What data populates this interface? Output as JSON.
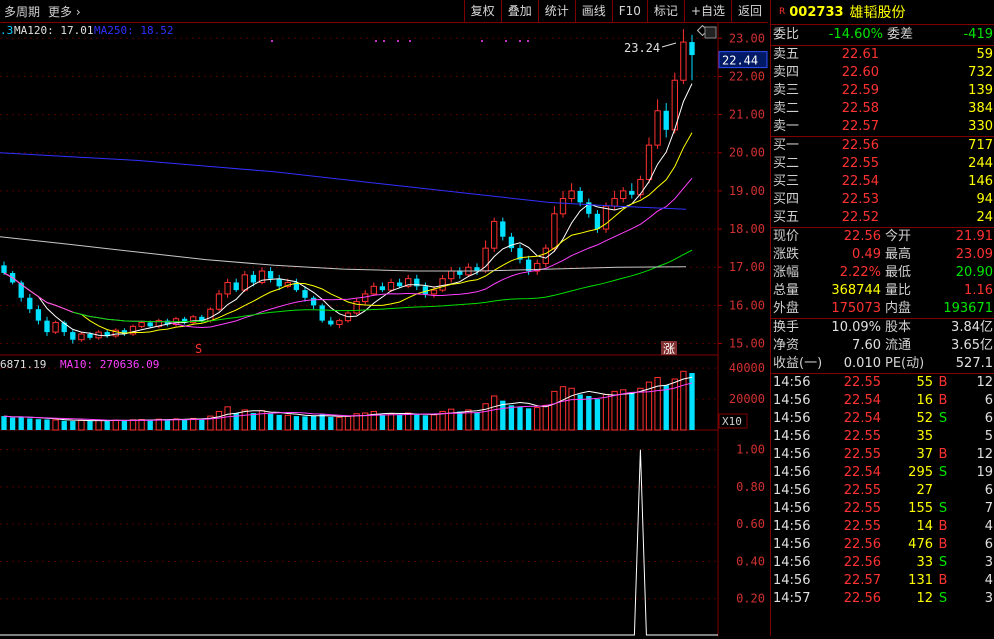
{
  "toolbar": {
    "period": "多周期",
    "more": "更多",
    "buttons": [
      "复权",
      "叠加",
      "统计",
      "画线",
      "F10",
      "标记",
      "+自选",
      "返回"
    ]
  },
  "chart": {
    "ma_legend": [
      {
        "label": ".3",
        "color": "#00ccff"
      },
      {
        "label": "MA120: 17.01",
        "color": "#e0e0e0"
      },
      {
        "label": "MA250: 18.52",
        "color": "#3030ff"
      }
    ],
    "price_ticks": [
      "23.00",
      "22.00",
      "21.00",
      "20.00",
      "19.00",
      "18.00",
      "17.00",
      "16.00",
      "15.00"
    ],
    "current_price": "22.44",
    "high_label": "23.24",
    "markers": [
      "S",
      "涨"
    ],
    "vol_legend": [
      {
        "label": "6871.19",
        "color": "#e0e0e0"
      },
      {
        "label": "MA10: 270636.09",
        "color": "#ff40ff"
      }
    ],
    "vol_ticks": [
      "40000",
      "20000"
    ],
    "vol_unit": "X10",
    "ind_ticks": [
      "1.00",
      "0.80",
      "0.60",
      "0.40",
      "0.20"
    ]
  },
  "quote": {
    "badge": "R",
    "code": "002733",
    "name": "雄韬股份",
    "weibi_label": "委比",
    "weibi": "-14.60%",
    "weicha_label": "委差",
    "weicha": "-419",
    "asks": [
      {
        "label": "卖五",
        "price": "22.61",
        "vol": "59"
      },
      {
        "label": "卖四",
        "price": "22.60",
        "vol": "732"
      },
      {
        "label": "卖三",
        "price": "22.59",
        "vol": "139"
      },
      {
        "label": "卖二",
        "price": "22.58",
        "vol": "384"
      },
      {
        "label": "卖一",
        "price": "22.57",
        "vol": "330"
      }
    ],
    "bids": [
      {
        "label": "买一",
        "price": "22.56",
        "vol": "717"
      },
      {
        "label": "买二",
        "price": "22.55",
        "vol": "244"
      },
      {
        "label": "买三",
        "price": "22.54",
        "vol": "146"
      },
      {
        "label": "买四",
        "price": "22.53",
        "vol": "94"
      },
      {
        "label": "买五",
        "price": "22.52",
        "vol": "24"
      }
    ],
    "stats": [
      {
        "l1": "现价",
        "v1": "22.56",
        "c1": "red",
        "l2": "今开",
        "v2": "21.91",
        "c2": "red"
      },
      {
        "l1": "涨跌",
        "v1": "0.49",
        "c1": "red",
        "l2": "最高",
        "v2": "23.09",
        "c2": "red"
      },
      {
        "l1": "涨幅",
        "v1": "2.22%",
        "c1": "red",
        "l2": "最低",
        "v2": "20.90",
        "c2": "grn"
      },
      {
        "l1": "总量",
        "v1": "368744",
        "c1": "yel",
        "l2": "量比",
        "v2": "1.16",
        "c2": "red"
      },
      {
        "l1": "外盘",
        "v1": "175073",
        "c1": "red",
        "l2": "内盘",
        "v2": "193671",
        "c2": "grn"
      }
    ],
    "stats2": [
      {
        "l1": "换手",
        "v1": "10.09%",
        "c1": "wht",
        "l2": "股本",
        "v2": "3.84亿",
        "c2": "wht"
      },
      {
        "l1": "净资",
        "v1": "7.60",
        "c1": "wht",
        "l2": "流通",
        "v2": "3.65亿",
        "c2": "wht"
      },
      {
        "l1": "收益(一)",
        "v1": "0.010",
        "c1": "wht",
        "l2": "PE(动)",
        "v2": "527.1",
        "c2": "wht"
      }
    ],
    "ticks": [
      {
        "t": "14:56",
        "p": "22.55",
        "v": "55",
        "bs": "B",
        "n": "12"
      },
      {
        "t": "14:56",
        "p": "22.54",
        "v": "16",
        "bs": "B",
        "n": "6"
      },
      {
        "t": "14:56",
        "p": "22.54",
        "v": "52",
        "bs": "S",
        "n": "6"
      },
      {
        "t": "14:56",
        "p": "22.55",
        "v": "35",
        "bs": "",
        "n": "5"
      },
      {
        "t": "14:56",
        "p": "22.55",
        "v": "37",
        "bs": "B",
        "n": "12"
      },
      {
        "t": "14:56",
        "p": "22.54",
        "v": "295",
        "bs": "S",
        "n": "19"
      },
      {
        "t": "14:56",
        "p": "22.55",
        "v": "27",
        "bs": "",
        "n": "6"
      },
      {
        "t": "14:56",
        "p": "22.55",
        "v": "155",
        "bs": "S",
        "n": "7"
      },
      {
        "t": "14:56",
        "p": "22.55",
        "v": "14",
        "bs": "B",
        "n": "4"
      },
      {
        "t": "14:56",
        "p": "22.56",
        "v": "476",
        "bs": "B",
        "n": "6"
      },
      {
        "t": "14:56",
        "p": "22.56",
        "v": "33",
        "bs": "S",
        "n": "3"
      },
      {
        "t": "14:56",
        "p": "22.57",
        "v": "131",
        "bs": "B",
        "n": "4"
      },
      {
        "t": "14:57",
        "p": "22.56",
        "v": "12",
        "bs": "S",
        "n": "3"
      }
    ]
  },
  "chart_data": {
    "type": "candlestick",
    "candles": [
      [
        17.05,
        16.85,
        17.15,
        16.8
      ],
      [
        16.85,
        16.6,
        16.9,
        16.55
      ],
      [
        16.6,
        16.2,
        16.65,
        16.1
      ],
      [
        16.2,
        15.9,
        16.3,
        15.8
      ],
      [
        15.9,
        15.6,
        16.0,
        15.5
      ],
      [
        15.6,
        15.3,
        15.7,
        15.2
      ],
      [
        15.3,
        15.55,
        15.6,
        15.25
      ],
      [
        15.55,
        15.3,
        15.6,
        15.2
      ],
      [
        15.3,
        15.1,
        15.35,
        15.0
      ],
      [
        15.1,
        15.25,
        15.3,
        15.05
      ],
      [
        15.25,
        15.15,
        15.3,
        15.1
      ],
      [
        15.15,
        15.3,
        15.35,
        15.1
      ],
      [
        15.3,
        15.2,
        15.35,
        15.15
      ],
      [
        15.2,
        15.35,
        15.4,
        15.15
      ],
      [
        15.35,
        15.25,
        15.4,
        15.2
      ],
      [
        15.25,
        15.45,
        15.5,
        15.2
      ],
      [
        15.45,
        15.55,
        15.6,
        15.4
      ],
      [
        15.55,
        15.45,
        15.6,
        15.4
      ],
      [
        15.45,
        15.6,
        15.65,
        15.4
      ],
      [
        15.6,
        15.5,
        15.65,
        15.45
      ],
      [
        15.5,
        15.65,
        15.7,
        15.45
      ],
      [
        15.65,
        15.55,
        15.7,
        15.5
      ],
      [
        15.55,
        15.7,
        15.75,
        15.5
      ],
      [
        15.7,
        15.6,
        15.75,
        15.55
      ],
      [
        15.6,
        15.9,
        15.95,
        15.55
      ],
      [
        15.9,
        16.3,
        16.4,
        15.85
      ],
      [
        16.3,
        16.6,
        16.7,
        16.2
      ],
      [
        16.6,
        16.4,
        16.7,
        16.35
      ],
      [
        16.4,
        16.8,
        16.9,
        16.35
      ],
      [
        16.8,
        16.6,
        16.9,
        16.5
      ],
      [
        16.6,
        16.9,
        17.0,
        16.55
      ],
      [
        16.9,
        16.7,
        17.0,
        16.6
      ],
      [
        16.7,
        16.5,
        16.8,
        16.4
      ],
      [
        16.5,
        16.6,
        16.7,
        16.45
      ],
      [
        16.6,
        16.4,
        16.7,
        16.35
      ],
      [
        16.4,
        16.2,
        16.5,
        16.1
      ],
      [
        16.2,
        16.0,
        16.25,
        15.9
      ],
      [
        16.0,
        15.6,
        16.05,
        15.55
      ],
      [
        15.6,
        15.5,
        15.7,
        15.45
      ],
      [
        15.5,
        15.6,
        15.65,
        15.4
      ],
      [
        15.6,
        15.8,
        15.85,
        15.55
      ],
      [
        15.8,
        16.1,
        16.2,
        15.75
      ],
      [
        16.1,
        16.3,
        16.4,
        16.0
      ],
      [
        16.3,
        16.5,
        16.6,
        16.25
      ],
      [
        16.5,
        16.4,
        16.6,
        16.35
      ],
      [
        16.4,
        16.6,
        16.7,
        16.35
      ],
      [
        16.6,
        16.5,
        16.7,
        16.45
      ],
      [
        16.5,
        16.7,
        16.8,
        16.45
      ],
      [
        16.7,
        16.5,
        16.8,
        16.4
      ],
      [
        16.5,
        16.3,
        16.6,
        16.2
      ],
      [
        16.3,
        16.4,
        16.5,
        16.2
      ],
      [
        16.4,
        16.7,
        16.8,
        16.35
      ],
      [
        16.7,
        16.9,
        17.0,
        16.6
      ],
      [
        16.9,
        16.8,
        17.0,
        16.7
      ],
      [
        16.8,
        17.0,
        17.1,
        16.75
      ],
      [
        17.0,
        16.9,
        17.1,
        16.8
      ],
      [
        16.9,
        17.5,
        17.7,
        16.85
      ],
      [
        17.5,
        18.2,
        18.3,
        17.4
      ],
      [
        18.2,
        17.8,
        18.3,
        17.7
      ],
      [
        17.8,
        17.5,
        17.9,
        17.4
      ],
      [
        17.5,
        17.2,
        17.6,
        17.1
      ],
      [
        17.2,
        16.9,
        17.3,
        16.8
      ],
      [
        16.9,
        17.1,
        17.2,
        16.8
      ],
      [
        17.1,
        17.5,
        17.6,
        17.0
      ],
      [
        17.5,
        18.4,
        18.6,
        17.4
      ],
      [
        18.4,
        18.8,
        19.0,
        18.3
      ],
      [
        18.8,
        19.0,
        19.2,
        18.7
      ],
      [
        19.0,
        18.7,
        19.1,
        18.6
      ],
      [
        18.7,
        18.4,
        18.8,
        18.3
      ],
      [
        18.4,
        18.0,
        18.5,
        17.9
      ],
      [
        18.0,
        18.6,
        18.7,
        17.9
      ],
      [
        18.6,
        18.8,
        19.0,
        18.5
      ],
      [
        18.8,
        19.0,
        19.1,
        18.7
      ],
      [
        19.0,
        18.9,
        19.2,
        18.8
      ],
      [
        18.9,
        19.3,
        19.4,
        18.8
      ],
      [
        19.3,
        20.2,
        20.4,
        19.2
      ],
      [
        20.2,
        21.1,
        21.4,
        20.1
      ],
      [
        21.1,
        20.6,
        21.3,
        20.4
      ],
      [
        20.6,
        21.9,
        22.1,
        20.5
      ],
      [
        21.9,
        22.9,
        23.24,
        21.8
      ],
      [
        22.9,
        22.56,
        23.09,
        21.9
      ]
    ],
    "volume_values": [
      9000,
      8000,
      8500,
      7500,
      7000,
      6800,
      6500,
      6000,
      5800,
      6200,
      6000,
      6300,
      6100,
      6400,
      6200,
      6600,
      6800,
      6500,
      7000,
      6800,
      7200,
      7000,
      7500,
      7300,
      9000,
      12000,
      15000,
      11000,
      13000,
      11000,
      12500,
      10500,
      9800,
      9500,
      9000,
      8800,
      9200,
      10000,
      8500,
      8200,
      8800,
      10500,
      11000,
      12000,
      10000,
      10500,
      9800,
      11000,
      10200,
      9500,
      9800,
      12000,
      13500,
      12000,
      13000,
      11500,
      17000,
      22000,
      19000,
      16000,
      15000,
      14000,
      14500,
      16000,
      25000,
      28000,
      27000,
      23000,
      22000,
      20000,
      23000,
      25000,
      26000,
      24000,
      27000,
      31000,
      34000,
      29000,
      33000,
      38000,
      36874
    ],
    "indicator_spike_index": 74,
    "indicator_spike_value": 1.0,
    "y_range": [
      14.7,
      23.4
    ],
    "vol_range": [
      0,
      44000
    ],
    "ind_range": [
      0,
      1.1
    ]
  }
}
